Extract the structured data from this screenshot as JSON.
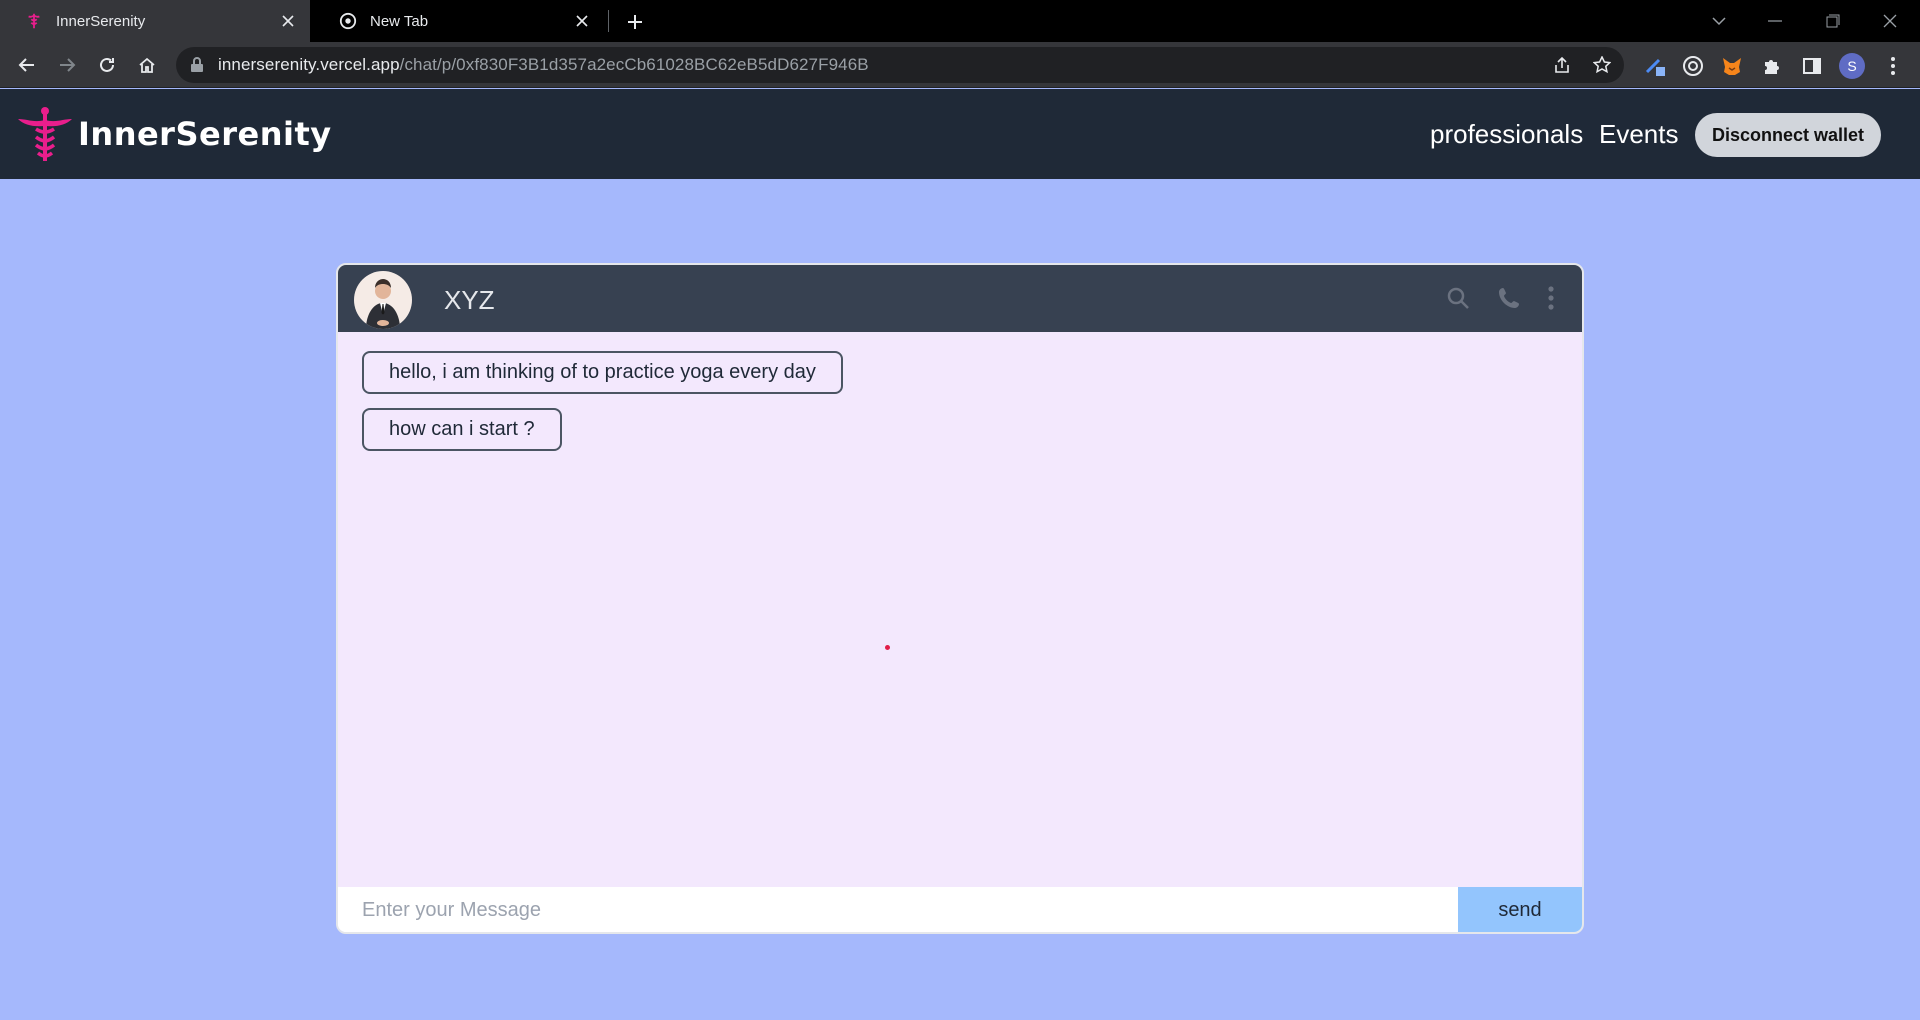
{
  "browser": {
    "tabs": [
      {
        "title": "InnerSerenity",
        "active": true
      },
      {
        "title": "New Tab",
        "active": false
      }
    ],
    "url_host": "innerserenity.vercel.app",
    "url_path": "/chat/p/0xf830F3B1d357a2ecCb61028BC62eB5dD627F946B",
    "profile_initial": "S"
  },
  "app": {
    "brand": "InnerSerenity",
    "nav": {
      "professionals": "professionals",
      "events": "Events",
      "disconnect": "Disconnect wallet"
    }
  },
  "chat": {
    "contact_name": "XYZ",
    "messages": [
      "hello, i am thinking of to practice yoga every day",
      "how can i start ?"
    ],
    "input_placeholder": "Enter your Message",
    "send_label": "send"
  },
  "colors": {
    "page_bg": "#a5b8fc",
    "navbar_bg": "#1f2937",
    "chat_bg": "#f3e8fd",
    "chat_header_bg": "#374151",
    "send_bg": "#93c5fd",
    "brand_accent": "#e91e8c"
  },
  "icons": {
    "tab_favicon": "caduceus-icon",
    "newtab_favicon": "chrome-icon",
    "header_actions": [
      "search-icon",
      "phone-icon",
      "more-vertical-icon"
    ]
  }
}
